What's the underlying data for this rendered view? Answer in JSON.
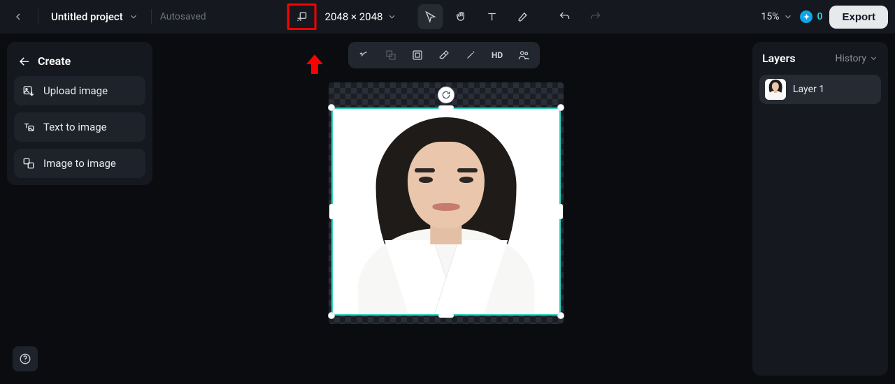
{
  "colors": {
    "accent": "#2dd4bf",
    "danger": "#ff0000"
  },
  "topbar": {
    "project_name": "Untitled project",
    "autosaved": "Autosaved",
    "dims": "2048 × 2048",
    "zoom": "15%",
    "credits": "0",
    "export": "Export"
  },
  "sidebar": {
    "title": "Create",
    "items": [
      {
        "label": "Upload image"
      },
      {
        "label": "Text to image"
      },
      {
        "label": "Image to image"
      }
    ]
  },
  "floatbar": {
    "hd": "HD"
  },
  "layers": {
    "title": "Layers",
    "history": "History",
    "items": [
      {
        "name": "Layer 1"
      }
    ]
  }
}
